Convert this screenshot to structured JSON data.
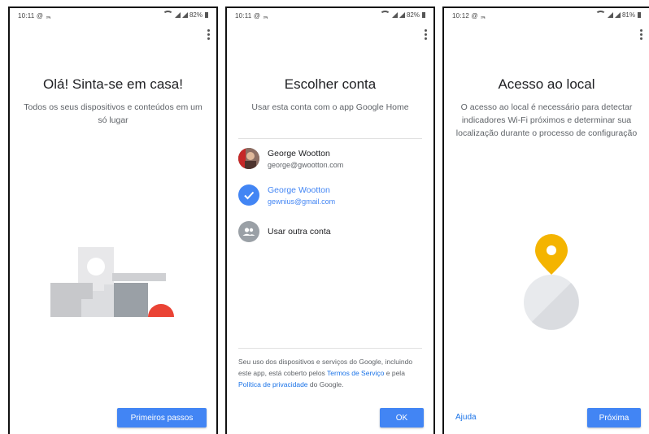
{
  "screens": [
    {
      "status": {
        "time": "10:11 @ ᆿ",
        "battery": "82%"
      },
      "title": "Olá! Sinta-se em casa!",
      "subtitle": "Todos os seus dispositivos e conteúdos em um só lugar",
      "button_label": "Primeiros passos",
      "icons": [
        "more-vert-icon"
      ]
    },
    {
      "status": {
        "time": "10:11 @ ᆿ",
        "battery": "82%"
      },
      "title": "Escolher conta",
      "subtitle": "Usar esta conta com o app Google Home",
      "accounts": [
        {
          "name": "George Wootton",
          "email": "george@gwootton.com",
          "selected": false
        },
        {
          "name": "George Wootton",
          "email": "gewnius@gmail.com",
          "selected": true
        }
      ],
      "other_account_label": "Usar outra conta",
      "legal": {
        "part1": "Seu uso dos dispositivos e serviços do Google, incluindo este app, está coberto pelos ",
        "terms_link": "Termos de Serviço",
        "part2": " e pela ",
        "privacy_link": "Política de privacidade",
        "part3": " do Google."
      },
      "button_label": "OK"
    },
    {
      "status": {
        "time": "10:12 @ ᆿ",
        "battery": "81%"
      },
      "title": "Acesso ao local",
      "subtitle": "O acesso ao local é necessário para detectar indicadores Wi-Fi próximos e determinar sua localização durante o processo de configuração",
      "help_label": "Ajuda",
      "button_label": "Próxima"
    }
  ],
  "colors": {
    "accent": "#4285f4",
    "link": "#1a73e8",
    "pin": "#f4b400",
    "red": "#ea4335"
  }
}
